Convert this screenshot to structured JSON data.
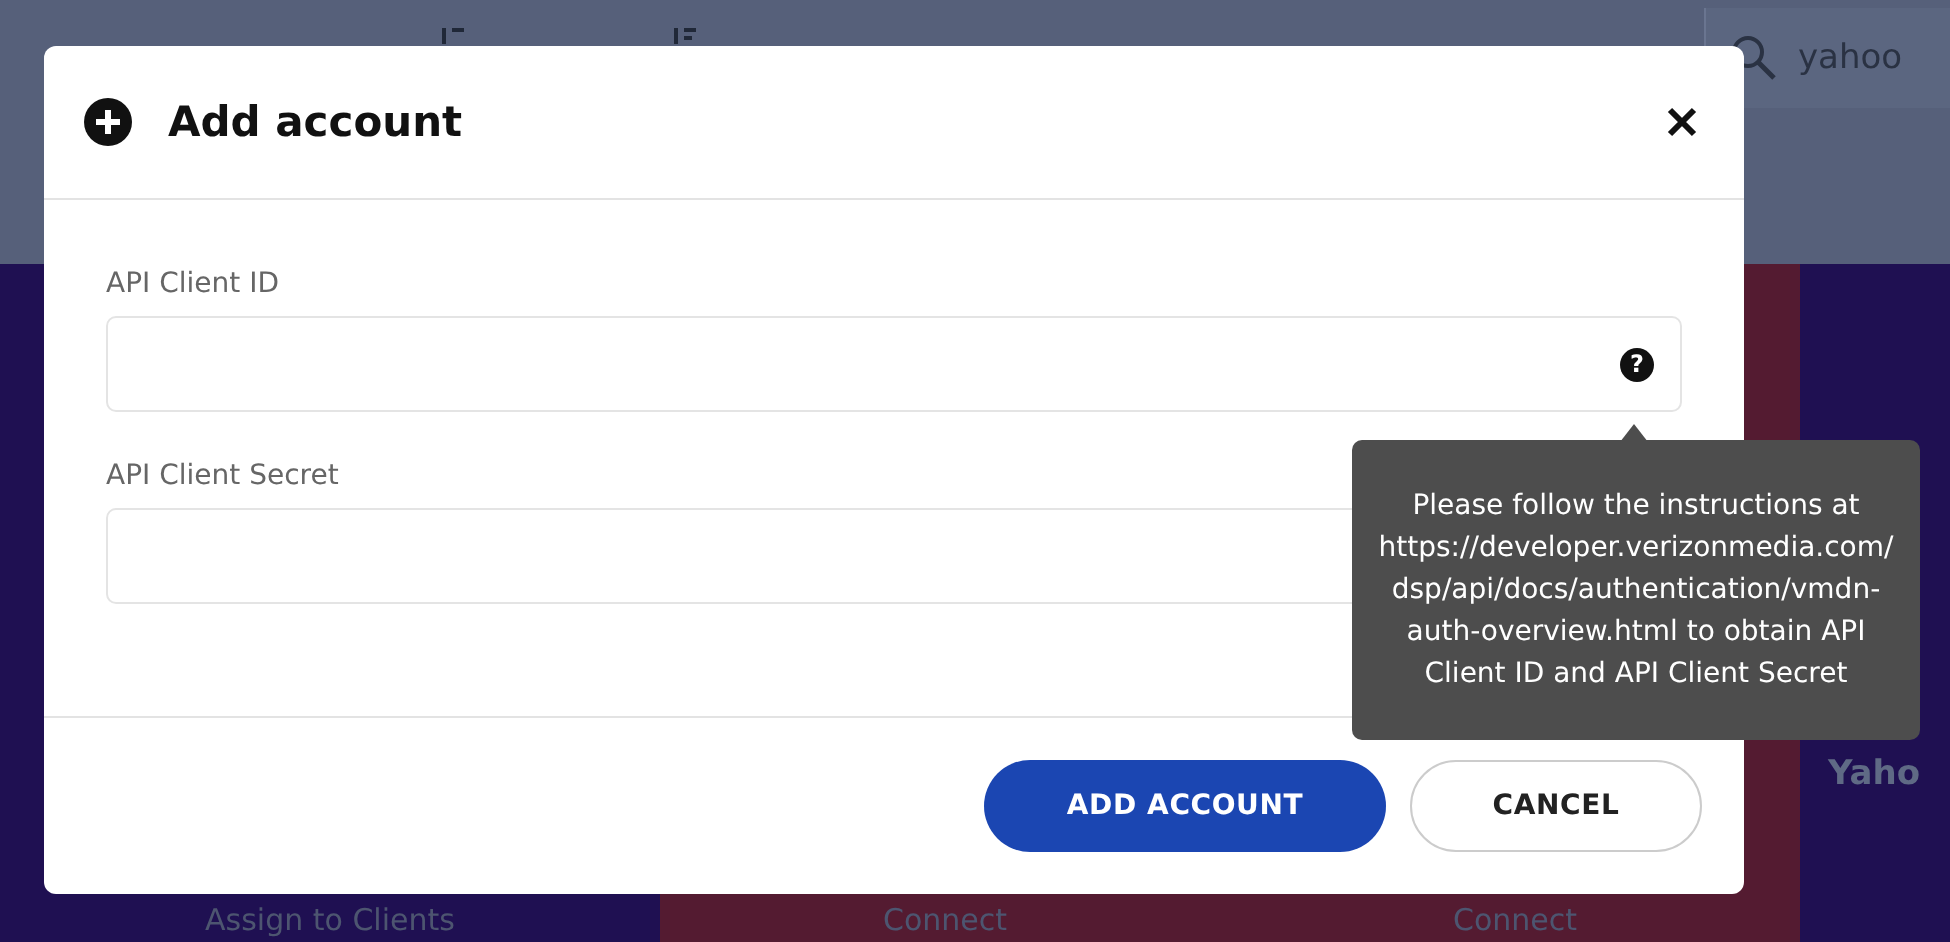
{
  "toolbar": {
    "items": [
      {
        "kind": "sort-asc"
      },
      {
        "kind": "sort-desc"
      }
    ],
    "search": {
      "value": "yahoo"
    }
  },
  "cards": [
    {
      "action": "Assign to Clients",
      "color": "#1f1052"
    },
    {
      "action": "Connect",
      "color": "#541b31"
    },
    {
      "action": "Connect",
      "color": "#541b31"
    },
    {
      "title": "Yaho",
      "color": "#1f1052"
    }
  ],
  "dialog": {
    "title": "Add account",
    "fields": [
      {
        "label": "API Client ID",
        "help": "?"
      },
      {
        "label": "API Client Secret"
      }
    ],
    "tooltip": "Please follow the instructions at https://developer.verizonmedia.com/dsp/api/docs/authentication/vmdn-auth-overview.html to obtain API Client ID and API Client Secret",
    "buttons": [
      {
        "label": "ADD ACCOUNT",
        "kind": "primary"
      },
      {
        "label": "CANCEL",
        "kind": "secondary"
      }
    ]
  }
}
